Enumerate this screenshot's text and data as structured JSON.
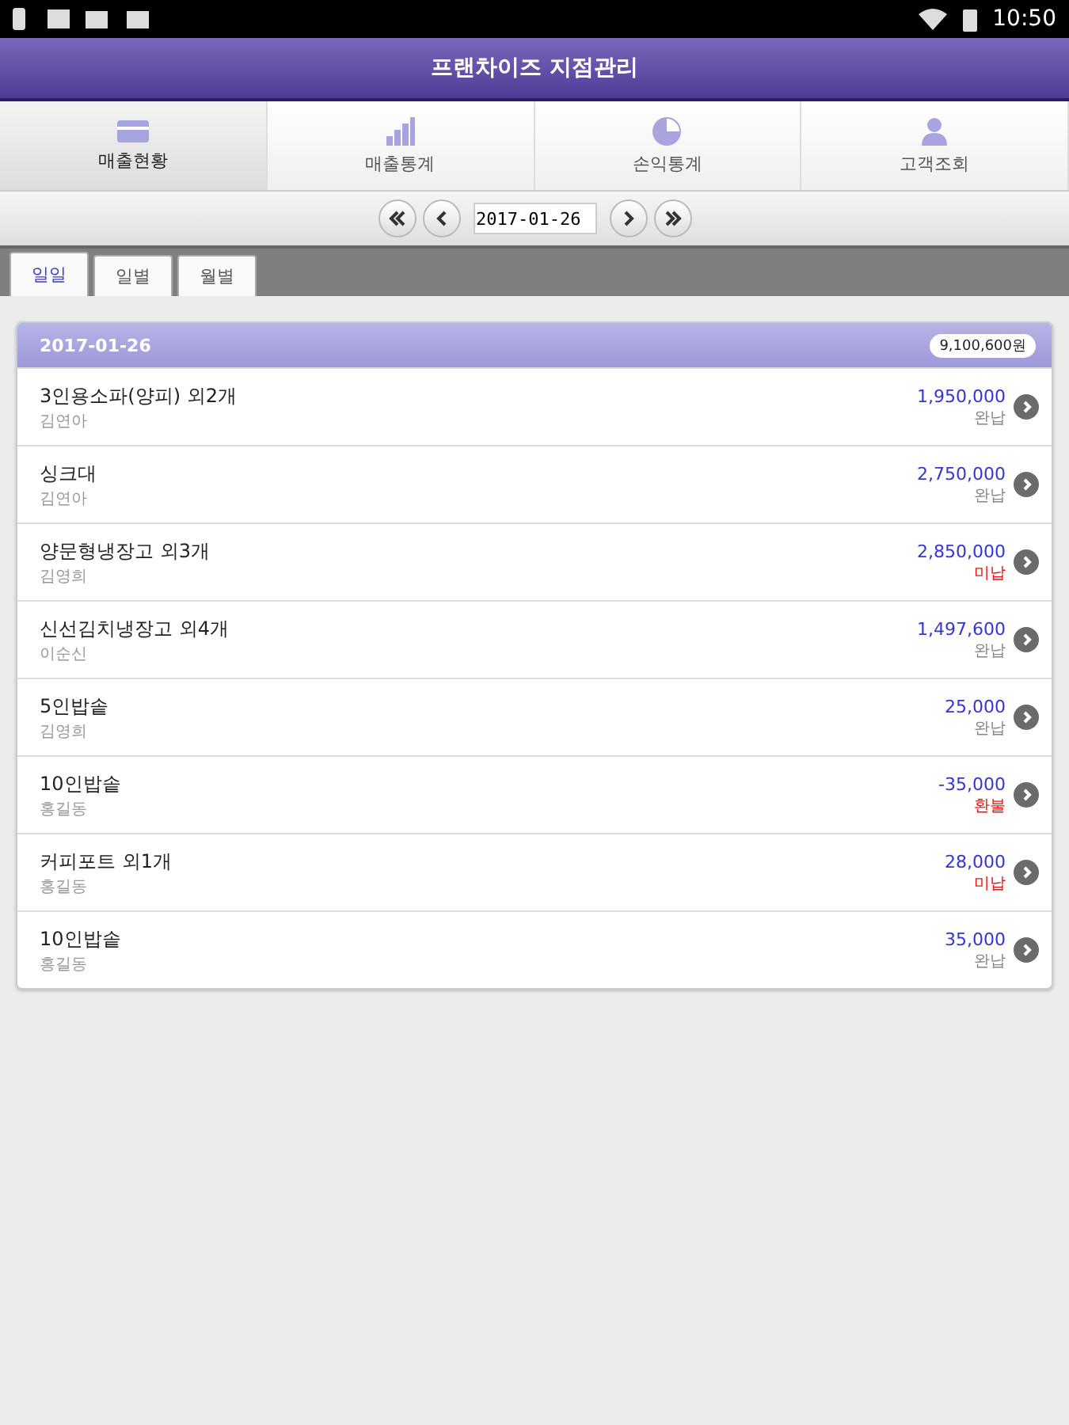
{
  "status_bar": {
    "time": "10:50"
  },
  "header": {
    "title": "프랜차이즈 지점관리"
  },
  "nav_tabs": [
    {
      "label": "매출현황",
      "kind": "card",
      "selected": true
    },
    {
      "label": "매출통계",
      "kind": "bars",
      "selected": false
    },
    {
      "label": "손익통계",
      "kind": "pie",
      "selected": false
    },
    {
      "label": "고객조회",
      "kind": "person",
      "selected": false
    }
  ],
  "date_nav": {
    "date": "2017-01-26"
  },
  "period_tabs": [
    {
      "label": "일일",
      "selected": true
    },
    {
      "label": "일별",
      "selected": false
    },
    {
      "label": "월별",
      "selected": false
    }
  ],
  "group": {
    "date": "2017-01-26",
    "total": "9,100,600원"
  },
  "rows": [
    {
      "item": "3인용소파(양피) 외2개",
      "customer": "김연아",
      "amount": "1,950,000",
      "status": "완납",
      "paid": true
    },
    {
      "item": "싱크대",
      "customer": "김연아",
      "amount": "2,750,000",
      "status": "완납",
      "paid": true
    },
    {
      "item": "양문형냉장고 외3개",
      "customer": "김영희",
      "amount": "2,850,000",
      "status": "미납",
      "paid": false
    },
    {
      "item": "신선김치냉장고 외4개",
      "customer": "이순신",
      "amount": "1,497,600",
      "status": "완납",
      "paid": true
    },
    {
      "item": "5인밥솥",
      "customer": "김영희",
      "amount": "25,000",
      "status": "완납",
      "paid": true
    },
    {
      "item": "10인밥솥",
      "customer": "홍길동",
      "amount": "-35,000",
      "status": "환불",
      "paid": false
    },
    {
      "item": "커피포트 외1개",
      "customer": "홍길동",
      "amount": "28,000",
      "status": "미납",
      "paid": false
    },
    {
      "item": "10인밥솥",
      "customer": "홍길동",
      "amount": "35,000",
      "status": "완납",
      "paid": true
    }
  ]
}
